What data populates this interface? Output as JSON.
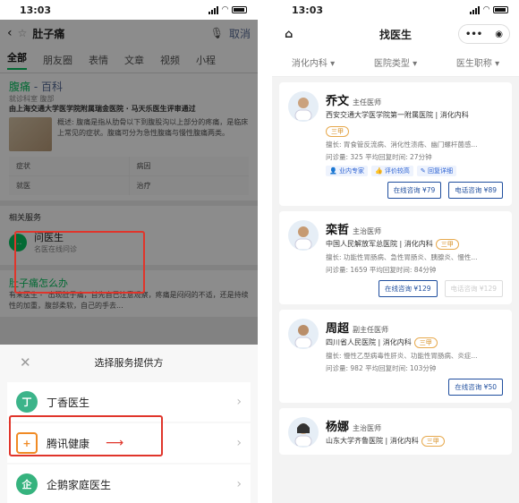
{
  "left": {
    "status": {
      "time": "13:03"
    },
    "search": {
      "query": "肚子痛",
      "cancel": "取消"
    },
    "tabs": [
      "全部",
      "朋友圈",
      "表情",
      "文章",
      "视频",
      "小程"
    ],
    "result1": {
      "title_kw": "腹痛",
      "title_rest": " - 百科",
      "source": "就诊科室  腹部",
      "banner": "由上海交通大学医学院附属瑞金医院 · 马天乐医生评审通过",
      "snippet": "概述: 腹痛是指从肋骨以下到腹股沟以上部分的疼痛，是临床上常见的症状。腹痛可分为急性腹痛与慢性腹痛两类。",
      "grid": [
        "症状",
        "病因",
        "就医",
        "治疗"
      ]
    },
    "services": {
      "header": "相关服务",
      "name": "问医生",
      "sub": "名医在线问诊"
    },
    "result2": {
      "title": "肚子痛怎么办",
      "text": "有来医生 - \"出现肚子痛，首先自己注意观察，疼痛是闷闷的不适，还是持续性的加重，腹部柔软，自己的手去..."
    },
    "sheet": {
      "title": "选择服务提供方",
      "providers": [
        "丁香医生",
        "腾讯健康",
        "企鹅家庭医生"
      ],
      "arrow": "⟶"
    }
  },
  "right": {
    "status": {
      "time": "13:03"
    },
    "nav": {
      "title": "找医生",
      "dots": "•••"
    },
    "filters": [
      "消化内科 ▾",
      "医院类型 ▾",
      "医生职称 ▾"
    ],
    "doctors": [
      {
        "name": "乔文",
        "title": "主任医师",
        "hospital": "西安交通大学医学院第一附属医院 | 消化内科",
        "grade": "三甲",
        "specialty": "擅长: 胃食管反流病、消化性溃疡、幽门螺杆菌感...",
        "stats": "问诊量: 325   平均回复时间: 27分钟",
        "labels": [
          "业内专家",
          "评价较高",
          "回复详细"
        ],
        "btn_online": "在线咨询 ¥79",
        "btn_phone": "电话咨询 ¥89"
      },
      {
        "name": "栾哲",
        "title": "主治医师",
        "hospital": "中国人民解放军总医院 | 消化内科",
        "grade": "三甲",
        "specialty": "擅长: 功能性胃肠病、急性胃肠炎、胰腺炎、慢性...",
        "stats": "问诊量: 1659   平均回复时间: 84分钟",
        "btn_online": "在线咨询 ¥129",
        "btn_phone": "电话咨询 ¥129"
      },
      {
        "name": "周超",
        "title": "副主任医师",
        "hospital": "四川省人民医院 | 消化内科",
        "grade": "三甲",
        "specialty": "擅长: 慢性乙型病毒性肝炎、功能性胃肠病、炎症...",
        "stats": "问诊量: 982   平均回复时间: 103分钟",
        "btn_online": "在线咨询 ¥50"
      },
      {
        "name": "杨娜",
        "title": "主治医师",
        "hospital": "山东大学齐鲁医院 | 消化内科",
        "grade": "三甲"
      }
    ]
  },
  "colors": {
    "accent_green": "#07c160",
    "link_blue": "#576b95",
    "brand_blue": "#1f4e9e",
    "highlight_red": "#e0352b"
  }
}
